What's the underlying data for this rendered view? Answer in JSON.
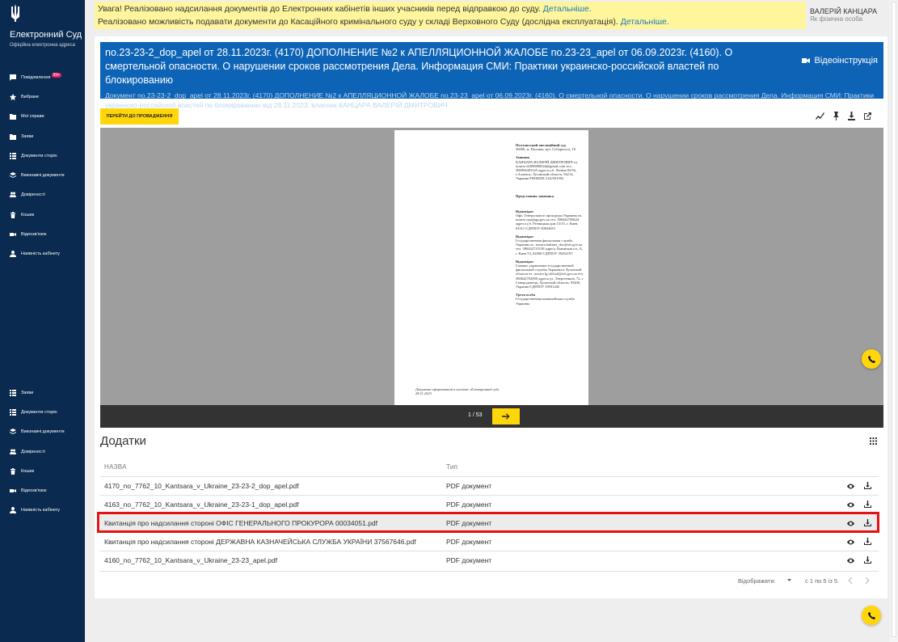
{
  "brand": {
    "title": "Електронний Суд",
    "subtitle": "Офіційна електронна адреса"
  },
  "sidebar": {
    "items": [
      {
        "label": "Повідомлення",
        "badge": "99+"
      },
      {
        "label": "Вибране"
      },
      {
        "label": "Мої справи"
      },
      {
        "label": "Заяви"
      },
      {
        "label": "Документи сторін"
      },
      {
        "label": "Виконавчі документи"
      },
      {
        "label": "Довіреності"
      },
      {
        "label": "Кошик"
      },
      {
        "label": "Відеозв'язок"
      },
      {
        "label": "Наявність кабінету"
      }
    ],
    "items2": [
      {
        "label": "Заяви"
      },
      {
        "label": "Документи сторін"
      },
      {
        "label": "Виконавчі документи"
      },
      {
        "label": "Довіреності"
      },
      {
        "label": "Кошик"
      },
      {
        "label": "Відеозв'язок"
      },
      {
        "label": "Наявність кабінету"
      }
    ]
  },
  "banner": {
    "line1": "Увага! Реалізовано надсилання документів до Електронних кабінетів інших учасників перед відправкою до суду.",
    "line2": "Реалізовано можливість подавати документи до Касаційного кримінального суду у складі Верховного Суду (дослідна експлуатація).",
    "link": "Детальніше."
  },
  "user": {
    "name": "ВАЛЕРІЙ КАНЦАРА",
    "role": "Як фізична особа"
  },
  "document": {
    "title": "no.23-23-2_dop_apel от 28.11.2023г. (4170) ДОПОЛНЕНИЕ №2 к АПЕЛЛЯЦИОННОЙ ЖАЛОБЕ no.23-23_apel от 06.09.2023г. (4160). О смертельной опасности. О нарушении сроков рассмотрения Дела. Информация СМИ: Практики украинско-российской властей по блокированию",
    "description": "Документ no.23-23-2_dop_apel от 28.11.2023г. (4170) ДОПОЛНЕНИЕ №2 к АПЕЛЛЯЦИОННОЙ ЖАЛОБЕ no.23-23_apel от 06.09.2023г. (4160). О смертельной опасности. О нарушении сроков рассмотрения Дела. Информация СМИ: Практики украинско-российской властей по блокированию від 28.11.2023, власник КАНЦАРА ВАЛЕРІЙ ДМИТРОВИЧ",
    "video_label": "Відеоінструкція",
    "go_button": "ПЕРЕЙТИ ДО ПРОВАДЖЕННЯ"
  },
  "preview": {
    "court_title": "Полтавський апеляційний суд",
    "court_addr": "36000, м. Полтава, вул. Соборності, 18",
    "applicant_h": "Заявник",
    "applicant": "КАНЦАРА ВАЛЕРІЙ ДМИТРОВИЧ ел. пошта d200880002d@gmail.com тел. 380994403325 адреса у.б. Леніна 82/56, г.Алчевск, Луганский область, 94214, Украина РНОКПП 2142501092",
    "rep_h": "Представник заявника",
    "resp1_h": "Відповідач",
    "resp1": "Офіс Генерального прокурора Украины ел. пошта opu@gp.gov.ua тел. 380442706624 адреса у.б. Резницкая дом.13/15, г. Киев, 01011 ЄДРПОУ 00034051",
    "resp2_h": "Відповідач",
    "resp2": "Государственная фискальная служба Украины ел. пошта kabinet_doc@sfs.gov.ua тел. 380442725158 адреса Львовская пл., 8, г. Киев 53, 02000 ЄДРПОУ 39292197",
    "resp3_h": "Відповідач",
    "resp3": "Главное управление государственной фискальной службы Украины в Луганской области ел. пошта lg.official@sfs.gov.ua тел. 380642702000 адреса ул. Энергетиков, 72, г. Северодонецк, Луганской области, 93400, Украина ЄДРПОУ 39591445",
    "third_h": "Третя особа",
    "third": "Государственная казначейская служба Украины",
    "footer": "Документ сформований в системі «Електронний суд» 28.11.2023"
  },
  "pager": {
    "label": "1 / 53"
  },
  "attachments": {
    "title": "Додатки",
    "col_name": "НАЗВА",
    "col_type": "Тип",
    "rows": [
      {
        "name": "4170_no_7762_10_Kantsara_v_Ukraine_23-23-2_dop_apel.pdf",
        "type": "PDF документ"
      },
      {
        "name": "4163_no_7762_10_Kantsara_v_Ukraine_23-23-1_dop_apel.pdf",
        "type": "PDF документ"
      },
      {
        "name": "Квитанція про надсилання стороні ОФІС ГЕНЕРАЛЬНОГО ПРОКУРОРА 00034051.pdf",
        "type": "PDF документ"
      },
      {
        "name": "Квитанція про надсилання стороні ДЕРЖАВНА КАЗНАЧЕЙСЬКА СЛУЖБА УКРАЇНИ 37567646.pdf",
        "type": "PDF документ"
      },
      {
        "name": "4160_no_7762_10_Kantsara_v_Ukraine_23-23_apel.pdf",
        "type": "PDF документ"
      }
    ],
    "per_page_label": "Відображати:",
    "range": "с 1 по 5 із 5"
  },
  "colors": {
    "sidebar": "#0a2a4f",
    "header": "#0d63b5",
    "accent": "#ffd60a",
    "highlight": "#e51111",
    "banner": "#fff59d"
  }
}
